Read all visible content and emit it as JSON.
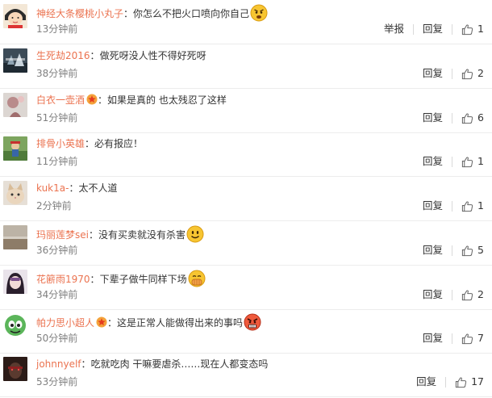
{
  "actions": {
    "report": "举报",
    "reply": "回复"
  },
  "comments": [
    {
      "user": "神经大条樱桃小丸子",
      "text": "你怎么不把火口喷向你自己",
      "time": "13分钟前",
      "likes": "1",
      "has_report": true,
      "badge": false,
      "emoji": "angry-emoji"
    },
    {
      "user": "生死劫2016",
      "text": "做死呀没人性不得好死呀",
      "time": "38分钟前",
      "likes": "2",
      "has_report": false,
      "badge": false,
      "emoji": ""
    },
    {
      "user": "白衣一壶酒",
      "text": "如果是真的  也太残忍了这样",
      "time": "51分钟前",
      "likes": "6",
      "has_report": false,
      "badge": true,
      "emoji": ""
    },
    {
      "user": "排骨小英雄",
      "text": "必有报应！",
      "time": "11分钟前",
      "likes": "1",
      "has_report": false,
      "badge": false,
      "emoji": ""
    },
    {
      "user": "kuk1a-",
      "text": "太不人道",
      "time": "2分钟前",
      "likes": "1",
      "has_report": false,
      "badge": false,
      "emoji": ""
    },
    {
      "user": "玛丽莲梦sei",
      "text": "没有买卖就没有杀害",
      "time": "36分钟前",
      "likes": "5",
      "has_report": false,
      "badge": false,
      "emoji": "smile-emoji"
    },
    {
      "user": "花簖雨1970",
      "text": "下辈子做牛同样下场",
      "time": "34分钟前",
      "likes": "2",
      "has_report": false,
      "badge": false,
      "emoji": "covering-mouth-emoji"
    },
    {
      "user": "帕力思小超人",
      "text": "这是正常人能做得出来的事吗",
      "time": "50分钟前",
      "likes": "7",
      "has_report": false,
      "badge": true,
      "emoji": "angry-red-emoji"
    },
    {
      "user": "johnnyelf",
      "text": "吃就吃肉 干嘛要虐杀……现在人都变态吗",
      "time": "53分钟前",
      "likes": "17",
      "has_report": false,
      "badge": false,
      "emoji": ""
    }
  ]
}
